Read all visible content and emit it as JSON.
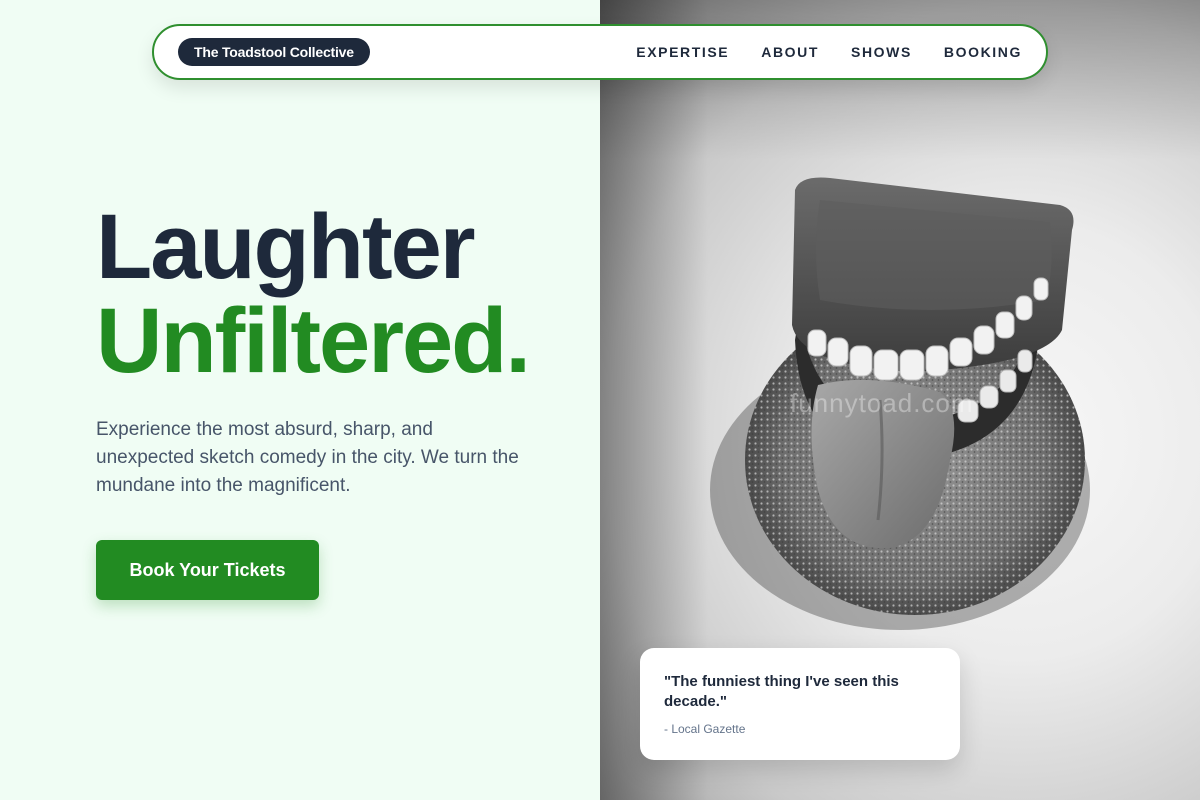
{
  "brand": {
    "name": "The Toadstool Collective"
  },
  "nav": {
    "items": [
      "EXPERTISE",
      "ABOUT",
      "SHOWS",
      "BOOKING"
    ]
  },
  "hero": {
    "title_line1": "Laughter",
    "title_line2": "Unfiltered.",
    "description": "Experience the most absurd, sharp, and unexpected sketch comedy in the city. We turn the mundane into the magnificent.",
    "cta_label": "Book Your Tickets"
  },
  "image": {
    "watermark": "funnytoad.com",
    "subject": "wind-up chattering teeth toy with tongue on a sponge"
  },
  "quote": {
    "text": "\"The funniest thing I've seen this decade.\"",
    "source": "- Local Gazette"
  },
  "colors": {
    "accent": "#228b22",
    "dark": "#1e293b",
    "background": "#f0fdf4",
    "muted": "#475569"
  }
}
